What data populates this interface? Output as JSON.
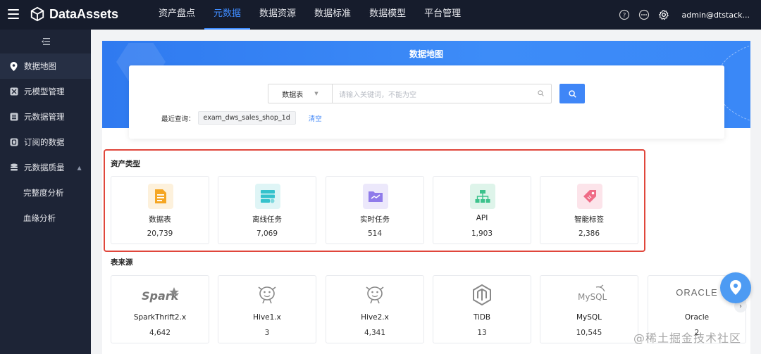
{
  "app": {
    "name": "DataAssets"
  },
  "nav": {
    "items": [
      "资产盘点",
      "元数据",
      "数据资源",
      "数据标准",
      "数据模型",
      "平台管理"
    ],
    "active_index": 1
  },
  "user": {
    "name": "admin@dtstack..."
  },
  "sidebar": {
    "items": [
      {
        "label": "数据地图",
        "icon": "map-pin-icon"
      },
      {
        "label": "元模型管理",
        "icon": "model-icon"
      },
      {
        "label": "元数据管理",
        "icon": "database-icon"
      },
      {
        "label": "订阅的数据",
        "icon": "subscribe-icon"
      },
      {
        "label": "元数据质量",
        "icon": "quality-icon"
      },
      {
        "label": "完整度分析"
      },
      {
        "label": "血缘分析"
      }
    ]
  },
  "banner": {
    "title": "数据地图"
  },
  "search": {
    "select_value": "数据表",
    "placeholder": "请输入关键词，不能为空",
    "recent_label": "最近查询：",
    "recent_tag": "exam_dws_sales_shop_1d",
    "clear_label": "清空"
  },
  "asset_types": {
    "title": "资产类型",
    "items": [
      {
        "label": "数据表",
        "count": "20,739",
        "icon": "table-icon",
        "color": "#f5a623",
        "bg": "#fdf1dc"
      },
      {
        "label": "离线任务",
        "count": "7,069",
        "icon": "offline-task-icon",
        "color": "#35c2cc",
        "bg": "#dff5f6"
      },
      {
        "label": "实时任务",
        "count": "514",
        "icon": "realtime-task-icon",
        "color": "#8f7bea",
        "bg": "#ece8fb"
      },
      {
        "label": "API",
        "count": "1,903",
        "icon": "api-icon",
        "color": "#3cc28c",
        "bg": "#def4ea"
      },
      {
        "label": "智能标签",
        "count": "2,386",
        "icon": "tag-icon",
        "color": "#ef6b86",
        "bg": "#fce4ea"
      }
    ]
  },
  "table_sources": {
    "title": "表来源",
    "items": [
      {
        "label": "SparkThrift2.x",
        "count": "4,642",
        "logo": "Spark"
      },
      {
        "label": "Hive1.x",
        "count": "3"
      },
      {
        "label": "Hive2.x",
        "count": "4,341"
      },
      {
        "label": "TiDB",
        "count": "13"
      },
      {
        "label": "MySQL",
        "count": "10,545",
        "logo": "MySQL"
      },
      {
        "label": "Oracle",
        "count": "2",
        "logo": "ORACLE"
      }
    ]
  },
  "watermark": "@稀土掘金技术社区"
}
